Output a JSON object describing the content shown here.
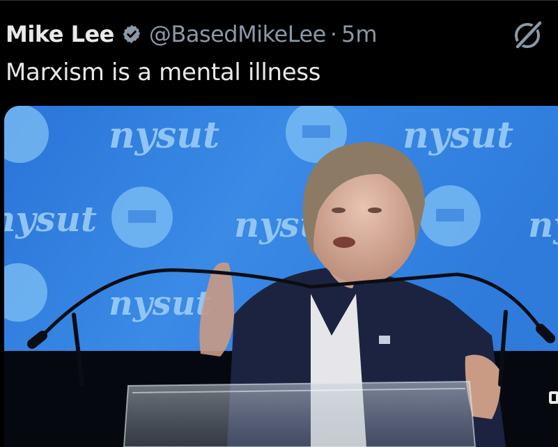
{
  "tweet": {
    "author_name": "Mike Lee",
    "handle": "@BasedMikeLee",
    "separator": "·",
    "timestamp": "5m",
    "text": "Marxism is a mental illness",
    "verified": true
  },
  "media": {
    "type": "video-frame",
    "backdrop_logo_text": "nysut"
  },
  "icons": {
    "verified": "verified-badge-icon",
    "grok": "grok-icon"
  },
  "colors": {
    "background": "#000000",
    "primary_text": "#e7e9ea",
    "secondary_text": "#8b98a5",
    "backdrop_blue": "#2f7fe0"
  }
}
